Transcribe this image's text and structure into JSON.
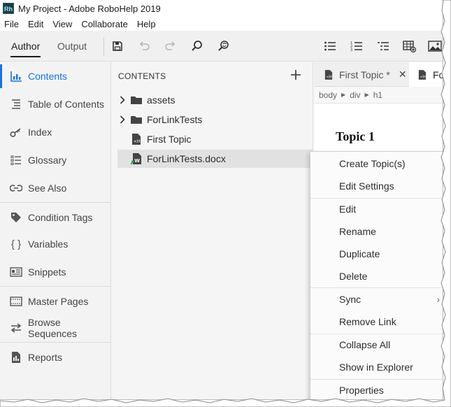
{
  "window": {
    "title": "My Project - Adobe RoboHelp 2019",
    "app_icon_text": "Rh"
  },
  "menubar": {
    "items": [
      "File",
      "Edit",
      "View",
      "Collaborate",
      "Help"
    ]
  },
  "toolbar": {
    "modes": [
      {
        "label": "Author",
        "active": true
      },
      {
        "label": "Output",
        "active": false
      }
    ],
    "icons": [
      "save-icon",
      "undo-icon",
      "redo-icon",
      "search-icon",
      "find-replace-icon",
      "bulleted-list-icon",
      "numbered-list-icon",
      "multilevel-list-icon",
      "insert-table-icon",
      "insert-image-icon"
    ]
  },
  "sidebar": {
    "items": [
      {
        "label": "Contents",
        "icon": "contents-icon",
        "active": true
      },
      {
        "label": "Table of Contents",
        "icon": "toc-icon",
        "active": false
      },
      {
        "label": "Index",
        "icon": "index-key-icon",
        "active": false
      },
      {
        "label": "Glossary",
        "icon": "glossary-icon",
        "active": false
      },
      {
        "label": "See Also",
        "icon": "see-also-icon",
        "active": false
      },
      {
        "label": "Condition Tags",
        "icon": "tag-icon",
        "active": false
      },
      {
        "label": "Variables",
        "icon": "braces-icon",
        "active": false
      },
      {
        "label": "Snippets",
        "icon": "snippet-icon",
        "active": false
      },
      {
        "label": "Master Pages",
        "icon": "master-page-icon",
        "active": false
      },
      {
        "label": "Browse Sequences",
        "icon": "browse-sequence-icon",
        "active": false
      },
      {
        "label": "Reports",
        "icon": "report-icon",
        "active": false
      }
    ]
  },
  "contents_panel": {
    "title": "CONTENTS",
    "add_button": "+",
    "tree": [
      {
        "label": "assets",
        "type": "folder",
        "expandable": true
      },
      {
        "label": "ForLinkTests",
        "type": "folder",
        "expandable": true
      },
      {
        "label": "First Topic",
        "type": "topic",
        "expandable": false
      },
      {
        "label": "ForLinkTests.docx",
        "type": "word-doc",
        "expandable": false,
        "selected": true
      }
    ]
  },
  "editor": {
    "tabs": [
      {
        "label": "First Topic *",
        "active": false,
        "closable": true
      },
      {
        "label": "For",
        "active": true,
        "closable": false
      }
    ],
    "breadcrumb": [
      "body",
      "div",
      "h1"
    ],
    "heading": "Topic 1"
  },
  "context_menu": {
    "items": [
      "Create Topic(s)",
      "Edit Settings",
      "Edit",
      "Rename",
      "Duplicate",
      "Delete",
      "Sync",
      "Remove Link",
      "Collapse All",
      "Show in Explorer",
      "Properties"
    ],
    "submenu_arrow": "›"
  },
  "colors": {
    "accent": "#1473e6",
    "selected_row": "#e1e1e1",
    "sidebar_bg": "#f3f3f3"
  }
}
